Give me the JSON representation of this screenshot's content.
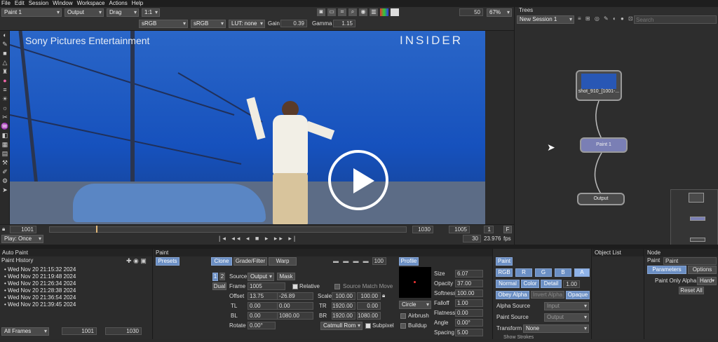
{
  "menu": [
    "File",
    "Edit",
    "Session",
    "Window",
    "Workspace",
    "Actions",
    "Help"
  ],
  "toolbar": {
    "node_select": "Paint 1",
    "output_select": "Output",
    "drag_select": "Drag",
    "zoom_ratio": "1:1",
    "colorspace1": "sRGB",
    "colorspace2": "sRGB",
    "colorspace3": "sRGB",
    "lut": "LUT: none",
    "gain_label": "Gain",
    "gain_value": "0.39",
    "gamma_label": "Gamma",
    "gamma_value": "1.15",
    "frame_value": "50",
    "zoom_percent": "67%"
  },
  "viewer": {
    "watermark_left": "Sony Pictures Entertainment",
    "watermark_right": "INSIDER"
  },
  "timeline": {
    "start": "1001",
    "current": "1030",
    "end": "1005",
    "step": "1",
    "f_label": "F",
    "frame_count": "30",
    "fps": "23.976",
    "fps_label": "fps",
    "play_mode": "Play: Once"
  },
  "trees": {
    "title": "Trees",
    "session": "New Session 1",
    "search_placeholder": "Search",
    "nodes": [
      "shot_910_[1001-...",
      "Paint 1",
      "Output"
    ]
  },
  "auto_paint": {
    "title": "Auto Paint",
    "history_title": "Paint History",
    "history": [
      "Wed Nov 20 21:15:32 2024",
      "Wed Nov 20 21:19:48 2024",
      "Wed Nov 20 21:26:34 2024",
      "Wed Nov 20 21:28:38 2024",
      "Wed Nov 20 21:36:54 2024",
      "Wed Nov 20 21:39:45 2024"
    ],
    "frames_select": "All Frames",
    "range_start": "1001",
    "range_end": "1030"
  },
  "paint": {
    "title": "Paint",
    "presets": "Presets",
    "tabs": [
      "Clone",
      "Grade/Filter",
      "Warp"
    ],
    "brush_value": "100",
    "tab_1": "1",
    "tab_2": "2",
    "dual": "Dual",
    "source_label": "Source",
    "source_value": "Output",
    "mask": "Mask",
    "frame_label": "Frame",
    "frame_value": "1005",
    "relative": "Relative",
    "source_match_move": "Source Match Move",
    "offset_label": "Offset",
    "offset_x": "13.75",
    "offset_y": "-26.89",
    "scale_label": "Scale",
    "scale_x": "100.00",
    "scale_y": "100.00",
    "tl_label": "TL",
    "tl_x": "0.00",
    "tl_y": "0.00",
    "tr_label": "TR",
    "tr_x": "1920.00",
    "tr_y": "0.00",
    "bl_label": "BL",
    "bl_x": "0.00",
    "bl_y": "1080.00",
    "br_label": "BR",
    "br_x": "1920.00",
    "br_y": "1080.00",
    "rotate_label": "Rotate",
    "rotate_value": "0.00°",
    "filter": "Catmull Rom",
    "subpixel": "Subpixel"
  },
  "profile": {
    "title": "Profile",
    "shape": "Circle",
    "airbrush": "Airbrush",
    "buildup": "Buildup",
    "size_label": "Size",
    "size": "6.07",
    "opacity_label": "Opacity",
    "opacity": "37.00",
    "softness_label": "Softness",
    "softness": "100.00",
    "falloff_label": "Falloff",
    "falloff": "1.00",
    "flatness_label": "Flatness",
    "flatness": "0.00",
    "angle_label": "Angle",
    "angle": "0.00°",
    "spacing_label": "Spacing",
    "spacing": "5.00"
  },
  "paint2": {
    "title": "Paint",
    "channels": [
      "RGB",
      "R",
      "G",
      "B",
      "A"
    ],
    "modes": [
      "Normal",
      "Color",
      "Detail"
    ],
    "detail_value": "1.00",
    "obey_alpha": "Obey Alpha",
    "invert_alpha": "Invert Alpha",
    "opaque": "Opaque",
    "alpha_source_label": "Alpha Source",
    "alpha_source": "Input",
    "paint_source_label": "Paint Source",
    "paint_source": "Output",
    "transform_label": "Transform",
    "transform": "None",
    "show_strokes": "Show Strokes"
  },
  "object_list": {
    "title": "Object List"
  },
  "node_panel": {
    "title": "Node",
    "paint_label": "Paint",
    "paint_value": "Paint",
    "parameters": "Parameters",
    "options": "Options",
    "paint_only_alpha": "Paint Only Alpha",
    "hard": "Hard",
    "reset_all": "Reset All"
  }
}
